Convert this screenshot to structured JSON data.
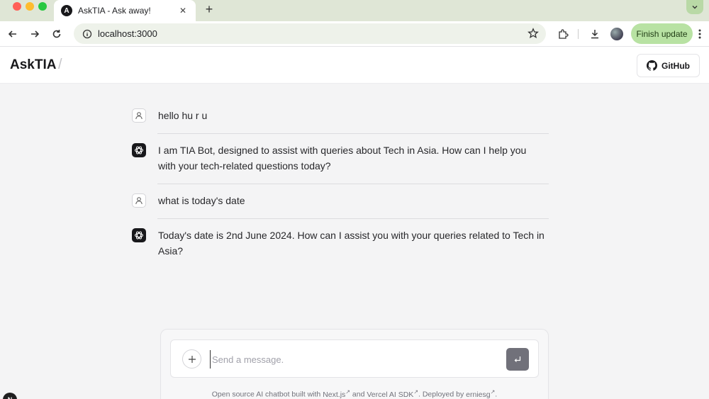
{
  "browser": {
    "tab_title": "AskTIA - Ask away!",
    "tab_favicon": "A",
    "tab_close": "✕",
    "new_tab": "+",
    "url": "localhost:3000",
    "finish_update": "Finish update"
  },
  "header": {
    "brand": "AskTIA",
    "separator": "/",
    "github_label": "GitHub"
  },
  "messages": [
    {
      "role": "user",
      "text": "hello hu r u"
    },
    {
      "role": "assistant",
      "text": "I am TIA Bot, designed to assist with queries about Tech in Asia. How can I help you with your tech-related questions today?"
    },
    {
      "role": "user",
      "text": "what is today's date"
    },
    {
      "role": "assistant",
      "text": "Today's date is 2nd June 2024. How can I assist you with your queries related to Tech in Asia?"
    }
  ],
  "composer": {
    "placeholder": "Send a message."
  },
  "footer": {
    "part1": "Open source AI chatbot built with ",
    "link_nextjs": "Next.js",
    "part2": " and ",
    "link_vercel": "Vercel AI SDK",
    "part3": ". Deployed by ",
    "link_author": "erniesg",
    "part4": ".",
    "arrow": "↗"
  },
  "corner_badge": "N",
  "colors": {
    "tabbar": "#dfe6d6",
    "finish_update_bg": "#b8e2a3",
    "send_button": "#71717a",
    "page_bg": "#f4f4f5"
  },
  "icons": {
    "back": "arrow-left-icon",
    "forward": "arrow-right-icon",
    "reload": "reload-icon",
    "site_info": "site-info-icon",
    "bookmark": "star-icon",
    "extensions": "puzzle-icon",
    "downloads": "download-icon",
    "profile": "profile-avatar-icon",
    "menu": "kebab-menu-icon",
    "github": "github-icon",
    "user": "user-icon",
    "bot": "openai-icon",
    "attach": "plus-icon",
    "send": "enter-icon"
  }
}
